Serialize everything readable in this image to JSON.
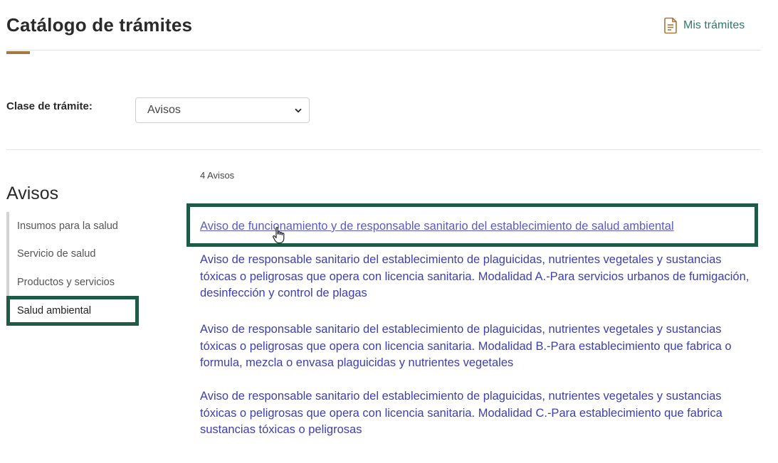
{
  "header": {
    "title": "Catálogo de trámites",
    "mis_tramites": "Mis trámites"
  },
  "filter": {
    "label": "Clase de trámite:",
    "selected": "Avisos"
  },
  "sidebar": {
    "title": "Avisos",
    "items": [
      {
        "label": "Insumos para la salud"
      },
      {
        "label": "Servicio de salud"
      },
      {
        "label": "Productos y servicios"
      },
      {
        "label": "Salud ambiental"
      }
    ],
    "active": "Salud ambiental"
  },
  "results": {
    "count_label": "4 Avisos",
    "items": [
      {
        "title": "Aviso de funcionamiento y de responsable sanitario del establecimiento de salud ambiental"
      },
      {
        "title": "Aviso de responsable sanitario del establecimiento de plaguicidas, nutrientes vegetales y sustancias tóxicas o peligrosas que opera con licencia sanitaria. Modalidad A.-Para servicios urbanos de fumigación, desinfección y control de plagas"
      },
      {
        "title": "Aviso de responsable sanitario del establecimiento de plaguicidas, nutrientes vegetales y sustancias tóxicas o peligrosas que opera con licencia sanitaria. Modalidad B.-Para establecimiento que fabrica o formula, mezcla o envasa plaguicidas y nutrientes vegetales"
      },
      {
        "title": "Aviso de responsable sanitario del establecimiento de plaguicidas, nutrientes vegetales y sustancias tóxicas o peligrosas que opera con licencia sanitaria. Modalidad C.-Para establecimiento que fabrica sustancias tóxicas o peligrosas"
      }
    ]
  },
  "colors": {
    "accent": "#a5783d",
    "link": "#3d3fae",
    "highlight": "#1f5a47",
    "mis_tramites": "#2a7d6a"
  },
  "icons": [
    "document-icon",
    "chevron-down-icon",
    "hand-pointer-cursor-icon"
  ]
}
